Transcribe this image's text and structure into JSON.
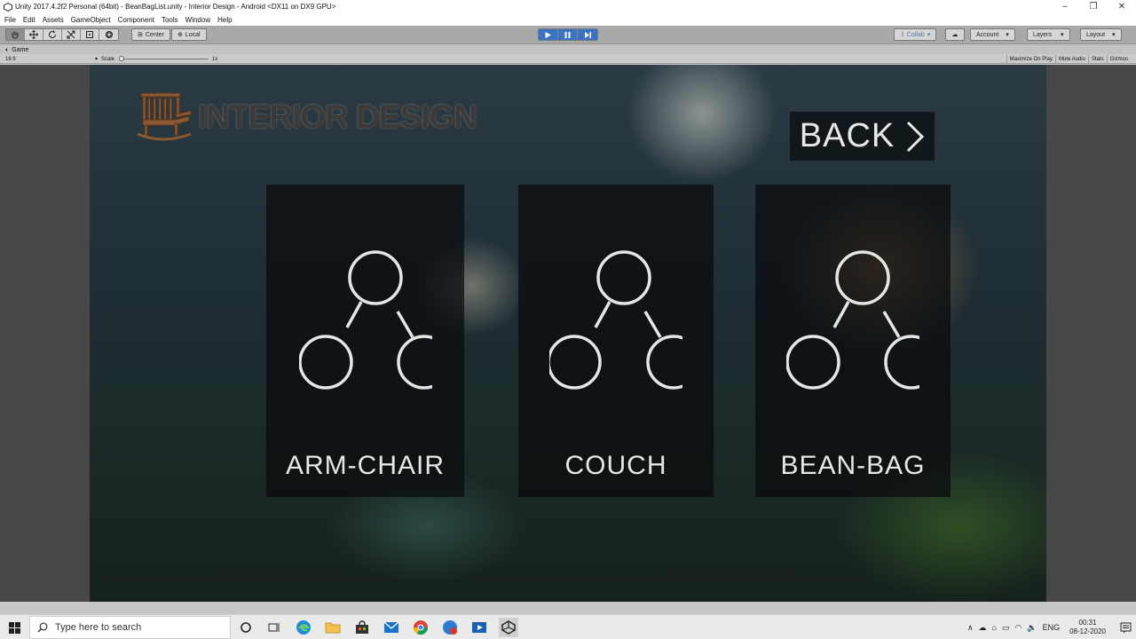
{
  "window": {
    "title": "Unity 2017.4.2f2 Personal (64bit) - BeanBagList.unity - Interior Design - Android <DX11 on DX9 GPU>",
    "controls": {
      "minimize": "–",
      "maximize": "❐",
      "close": "✕"
    }
  },
  "menu": [
    "File",
    "Edit",
    "Assets",
    "GameObject",
    "Component",
    "Tools",
    "Window",
    "Help"
  ],
  "toolbar": {
    "transform_tools": [
      "hand-icon",
      "move-icon",
      "rotate-icon",
      "scale-icon",
      "rect-icon",
      "transform-icon"
    ],
    "pivot_label": "Center",
    "space_label": "Local",
    "collab_label": "Collab",
    "account_label": "Account",
    "layers_label": "Layers",
    "layout_label": "Layout"
  },
  "game_tab": {
    "label": "Game",
    "aspect": "16:9",
    "scale_label": "Scale",
    "scale_value": "1x",
    "tools": [
      "Maximize On Play",
      "Mute Audio",
      "Stats",
      "Gizmos"
    ]
  },
  "game": {
    "logo_text": "INTERIOR DESIGN",
    "back_label": "BACK",
    "cards": [
      {
        "label": "ARM-CHAIR"
      },
      {
        "label": "COUCH"
      },
      {
        "label": "BEAN-BAG"
      }
    ]
  },
  "taskbar": {
    "search_placeholder": "Type here to search",
    "language": "ENG",
    "time": "00:31",
    "date": "08-12-2020"
  },
  "colors": {
    "accent_play": "#3a72c4",
    "card_bg": "#0a0c0e",
    "label_text": "#e6e6e6"
  }
}
